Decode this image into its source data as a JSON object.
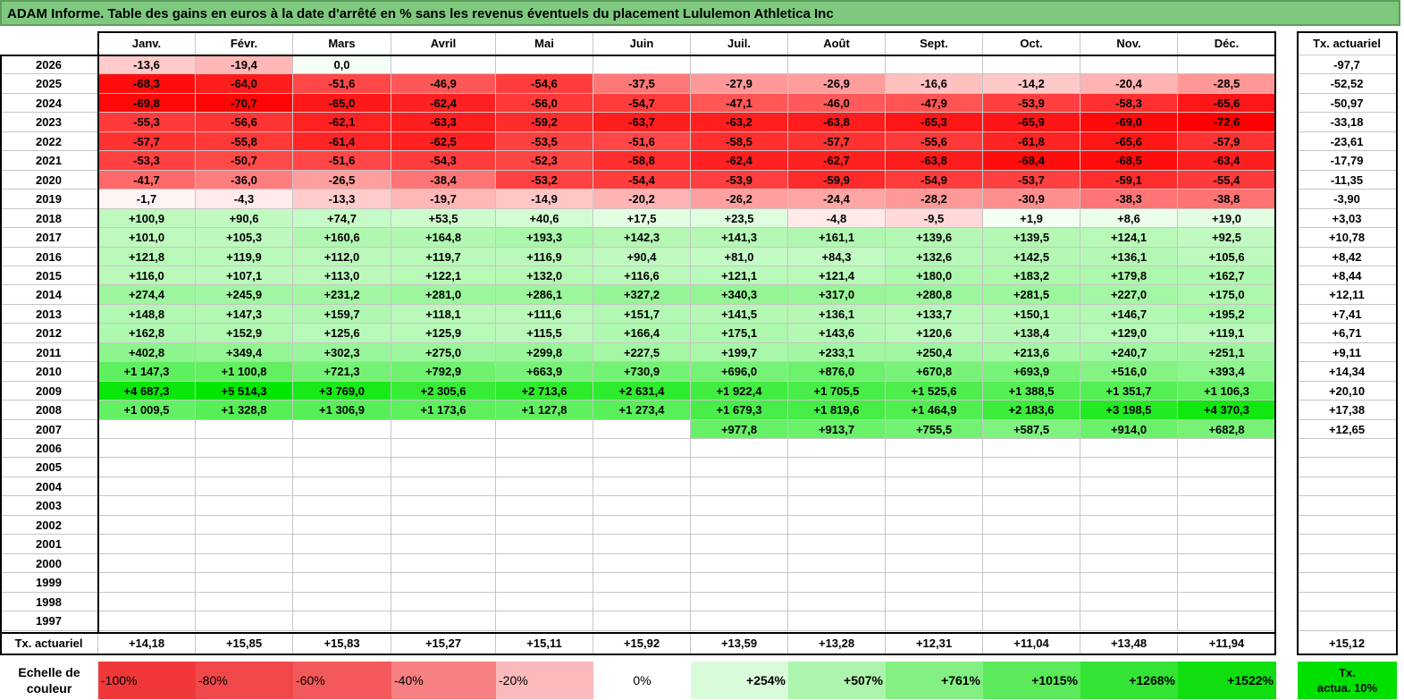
{
  "title": "ADAM Informe. Table des gains en euros à la date d'arrêté en % sans les revenus éventuels du placement Lululemon Athletica Inc",
  "months": [
    "Janv.",
    "Févr.",
    "Mars",
    "Avril",
    "Mai",
    "Juin",
    "Juil.",
    "Août",
    "Sept.",
    "Oct.",
    "Nov.",
    "Déc."
  ],
  "tx_header": "Tx. actuariel",
  "rows": [
    {
      "year": "2026",
      "values": [
        "-13,6",
        "-19,4",
        "0,0",
        "",
        "",
        "",
        "",
        "",
        "",
        "",
        "",
        ""
      ],
      "tx": "-97,7"
    },
    {
      "year": "2025",
      "values": [
        "-68,3",
        "-64,0",
        "-51,6",
        "-46,9",
        "-54,6",
        "-37,5",
        "-27,9",
        "-26,9",
        "-16,6",
        "-14,2",
        "-20,4",
        "-28,5"
      ],
      "tx": "-52,52"
    },
    {
      "year": "2024",
      "values": [
        "-69,8",
        "-70,7",
        "-65,0",
        "-62,4",
        "-56,0",
        "-54,7",
        "-47,1",
        "-46,0",
        "-47,9",
        "-53,9",
        "-58,3",
        "-65,6"
      ],
      "tx": "-50,97"
    },
    {
      "year": "2023",
      "values": [
        "-55,3",
        "-56,6",
        "-62,1",
        "-63,3",
        "-59,2",
        "-63,7",
        "-63,2",
        "-63,8",
        "-65,3",
        "-65,9",
        "-69,0",
        "-72,6"
      ],
      "tx": "-33,18"
    },
    {
      "year": "2022",
      "values": [
        "-57,7",
        "-55,8",
        "-61,4",
        "-62,5",
        "-53,5",
        "-51,6",
        "-58,5",
        "-57,7",
        "-55,6",
        "-61,8",
        "-65,6",
        "-57,9"
      ],
      "tx": "-23,61"
    },
    {
      "year": "2021",
      "values": [
        "-53,3",
        "-50,7",
        "-51,6",
        "-54,3",
        "-52,3",
        "-58,8",
        "-62,4",
        "-62,7",
        "-63,8",
        "-68,4",
        "-68,5",
        "-63,4"
      ],
      "tx": "-17,79"
    },
    {
      "year": "2020",
      "values": [
        "-41,7",
        "-36,0",
        "-26,5",
        "-38,4",
        "-53,2",
        "-54,4",
        "-53,9",
        "-59,9",
        "-54,9",
        "-53,7",
        "-59,1",
        "-55,4"
      ],
      "tx": "-11,35"
    },
    {
      "year": "2019",
      "values": [
        "-1,7",
        "-4,3",
        "-13,3",
        "-19,7",
        "-14,9",
        "-20,2",
        "-26,2",
        "-24,4",
        "-28,2",
        "-30,9",
        "-38,3",
        "-38,8"
      ],
      "tx": "-3,90"
    },
    {
      "year": "2018",
      "values": [
        "+100,9",
        "+90,6",
        "+74,7",
        "+53,5",
        "+40,6",
        "+17,5",
        "+23,5",
        "-4,8",
        "-9,5",
        "+1,9",
        "+8,6",
        "+19,0"
      ],
      "tx": "+3,03"
    },
    {
      "year": "2017",
      "values": [
        "+101,0",
        "+105,3",
        "+160,6",
        "+164,8",
        "+193,3",
        "+142,3",
        "+141,3",
        "+161,1",
        "+139,6",
        "+139,5",
        "+124,1",
        "+92,5"
      ],
      "tx": "+10,78"
    },
    {
      "year": "2016",
      "values": [
        "+121,8",
        "+119,9",
        "+112,0",
        "+119,7",
        "+116,9",
        "+90,4",
        "+81,0",
        "+84,3",
        "+132,6",
        "+142,5",
        "+136,1",
        "+105,6"
      ],
      "tx": "+8,42"
    },
    {
      "year": "2015",
      "values": [
        "+116,0",
        "+107,1",
        "+113,0",
        "+122,1",
        "+132,0",
        "+116,6",
        "+121,1",
        "+121,4",
        "+180,0",
        "+183,2",
        "+179,8",
        "+162,7"
      ],
      "tx": "+8,44"
    },
    {
      "year": "2014",
      "values": [
        "+274,4",
        "+245,9",
        "+231,2",
        "+281,0",
        "+286,1",
        "+327,2",
        "+340,3",
        "+317,0",
        "+280,8",
        "+281,5",
        "+227,0",
        "+175,0"
      ],
      "tx": "+12,11"
    },
    {
      "year": "2013",
      "values": [
        "+148,8",
        "+147,3",
        "+159,7",
        "+118,1",
        "+111,6",
        "+151,7",
        "+141,5",
        "+136,1",
        "+133,7",
        "+150,1",
        "+146,7",
        "+195,2"
      ],
      "tx": "+7,41"
    },
    {
      "year": "2012",
      "values": [
        "+162,8",
        "+152,9",
        "+125,6",
        "+125,9",
        "+115,5",
        "+166,4",
        "+175,1",
        "+143,6",
        "+120,6",
        "+138,4",
        "+129,0",
        "+119,1"
      ],
      "tx": "+6,71"
    },
    {
      "year": "2011",
      "values": [
        "+402,8",
        "+349,4",
        "+302,3",
        "+275,0",
        "+299,8",
        "+227,5",
        "+199,7",
        "+233,1",
        "+250,4",
        "+213,6",
        "+240,7",
        "+251,1"
      ],
      "tx": "+9,11"
    },
    {
      "year": "2010",
      "values": [
        "+1 147,3",
        "+1 100,8",
        "+721,3",
        "+792,9",
        "+663,9",
        "+730,9",
        "+696,0",
        "+876,0",
        "+670,8",
        "+693,9",
        "+516,0",
        "+393,4"
      ],
      "tx": "+14,34"
    },
    {
      "year": "2009",
      "values": [
        "+4 687,3",
        "+5 514,3",
        "+3 769,0",
        "+2 305,6",
        "+2 713,6",
        "+2 631,4",
        "+1 922,4",
        "+1 705,5",
        "+1 525,6",
        "+1 388,5",
        "+1 351,7",
        "+1 106,3"
      ],
      "tx": "+20,10"
    },
    {
      "year": "2008",
      "values": [
        "+1 009,5",
        "+1 328,8",
        "+1 306,9",
        "+1 173,6",
        "+1 127,8",
        "+1 273,4",
        "+1 679,3",
        "+1 819,6",
        "+1 464,9",
        "+2 183,6",
        "+3 198,5",
        "+4 370,3"
      ],
      "tx": "+17,38"
    },
    {
      "year": "2007",
      "values": [
        "",
        "",
        "",
        "",
        "",
        "",
        "+977,8",
        "+913,7",
        "+755,5",
        "+587,5",
        "+914,0",
        "+682,8"
      ],
      "tx": "+12,65"
    },
    {
      "year": "2006",
      "values": [
        "",
        "",
        "",
        "",
        "",
        "",
        "",
        "",
        "",
        "",
        "",
        ""
      ],
      "tx": ""
    },
    {
      "year": "2005",
      "values": [
        "",
        "",
        "",
        "",
        "",
        "",
        "",
        "",
        "",
        "",
        "",
        ""
      ],
      "tx": ""
    },
    {
      "year": "2004",
      "values": [
        "",
        "",
        "",
        "",
        "",
        "",
        "",
        "",
        "",
        "",
        "",
        ""
      ],
      "tx": ""
    },
    {
      "year": "2003",
      "values": [
        "",
        "",
        "",
        "",
        "",
        "",
        "",
        "",
        "",
        "",
        "",
        ""
      ],
      "tx": ""
    },
    {
      "year": "2002",
      "values": [
        "",
        "",
        "",
        "",
        "",
        "",
        "",
        "",
        "",
        "",
        "",
        ""
      ],
      "tx": ""
    },
    {
      "year": "2001",
      "values": [
        "",
        "",
        "",
        "",
        "",
        "",
        "",
        "",
        "",
        "",
        "",
        ""
      ],
      "tx": ""
    },
    {
      "year": "2000",
      "values": [
        "",
        "",
        "",
        "",
        "",
        "",
        "",
        "",
        "",
        "",
        "",
        ""
      ],
      "tx": ""
    },
    {
      "year": "1999",
      "values": [
        "",
        "",
        "",
        "",
        "",
        "",
        "",
        "",
        "",
        "",
        "",
        ""
      ],
      "tx": ""
    },
    {
      "year": "1998",
      "values": [
        "",
        "",
        "",
        "",
        "",
        "",
        "",
        "",
        "",
        "",
        "",
        ""
      ],
      "tx": ""
    },
    {
      "year": "1997",
      "values": [
        "",
        "",
        "",
        "",
        "",
        "",
        "",
        "",
        "",
        "",
        "",
        ""
      ],
      "tx": ""
    }
  ],
  "footer": {
    "label": "Tx. actuariel",
    "values": [
      "+14,18",
      "+15,85",
      "+15,83",
      "+15,27",
      "+15,11",
      "+15,92",
      "+13,59",
      "+13,28",
      "+12,31",
      "+11,04",
      "+13,48",
      "+11,94"
    ],
    "tx": "+15,12"
  },
  "legend": {
    "label_line1": "Echelle de",
    "label_line2": "couleur",
    "items": [
      {
        "text": "-100%",
        "color": "#f0383a"
      },
      {
        "text": "-80%",
        "color": "#f1494b"
      },
      {
        "text": "-60%",
        "color": "#f3595b"
      },
      {
        "text": "-40%",
        "color": "#f68082"
      },
      {
        "text": "-20%",
        "color": "#fab9ba"
      },
      {
        "text": "0%",
        "color": "#ffffff"
      },
      {
        "text": "+254%",
        "color": "#d9fbd9"
      },
      {
        "text": "+507%",
        "color": "#adf5ad"
      },
      {
        "text": "+761%",
        "color": "#84f084"
      },
      {
        "text": "+1015%",
        "color": "#5aea5a"
      },
      {
        "text": "+1268%",
        "color": "#34e434"
      },
      {
        "text": "+1522%",
        "color": "#10de10"
      }
    ],
    "tx_line1": "Tx.",
    "tx_line2": "actua. 10%",
    "tx_color": "#00e000"
  },
  "colors": {
    "title_bg": "#7fc97f",
    "negative_max": "#ff0000",
    "positive_max": "#00e600"
  }
}
